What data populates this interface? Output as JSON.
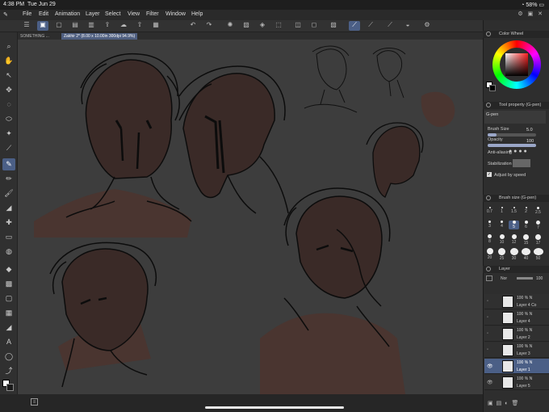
{
  "status": {
    "time": "4:38 PM",
    "date": "Tue Jun 29",
    "battery": "58%"
  },
  "menu": [
    "File",
    "Edit",
    "Animation",
    "Layer",
    "Select",
    "View",
    "Filter",
    "Window",
    "Help"
  ],
  "tabs": [
    {
      "label": "SOMETHING ..."
    },
    {
      "label": "Zakhir 2* (8.00 x 10.00in 300dpi 94.9%)"
    }
  ],
  "panels": {
    "color_wheel": {
      "title": "Color Wheel"
    },
    "tool_property": {
      "title": "Tool property (G-pen)",
      "tool_name": "G-pen",
      "brush_size_label": "Brush Size",
      "brush_size_value": "5.0",
      "opacity_label": "Opacity",
      "opacity_value": "100",
      "antialias_label": "Anti-aliasing",
      "stabilization_label": "Stabilization",
      "adjust_label": "Adjust by speed"
    },
    "brush_size": {
      "title": "Brush size (G-pen)",
      "sizes": [
        "0.7",
        "1",
        "1.5",
        "2",
        "2.5",
        "3",
        "4",
        "5",
        "6",
        "7",
        "8",
        "10",
        "12",
        "15",
        "17",
        "20",
        "25",
        "30",
        "40",
        "50"
      ]
    },
    "layer": {
      "title": "Layer",
      "blend_mode": "Nor",
      "opacity": "100",
      "layers": [
        {
          "pct": "100 %",
          "mode": "N",
          "name": "Layer 4 Co"
        },
        {
          "pct": "100 %",
          "mode": "N",
          "name": "Layer 4"
        },
        {
          "pct": "100 %",
          "mode": "N",
          "name": "Layer 2"
        },
        {
          "pct": "100 %",
          "mode": "N",
          "name": "Layer 3"
        },
        {
          "pct": "100 %",
          "mode": "N",
          "name": "Layer 1"
        },
        {
          "pct": "100 %",
          "mode": "N",
          "name": "Layer 5"
        }
      ]
    }
  }
}
